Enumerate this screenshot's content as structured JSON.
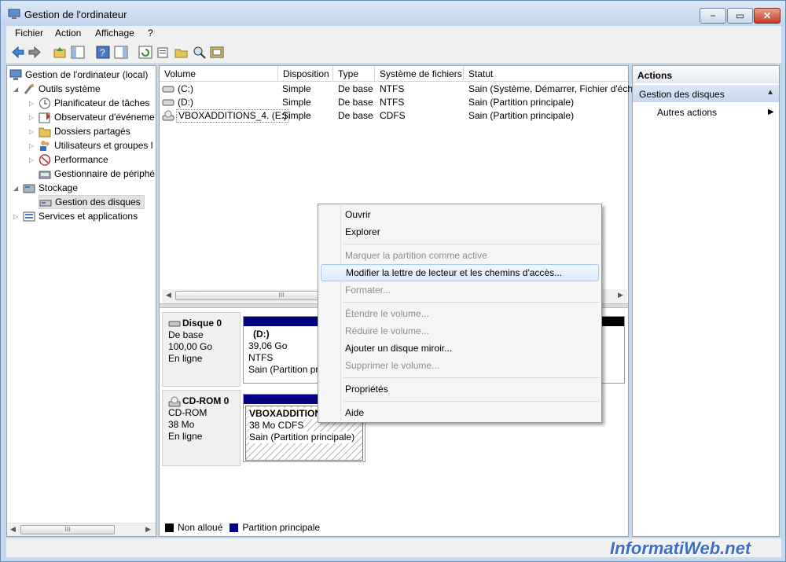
{
  "window": {
    "title": "Gestion de l'ordinateur",
    "min": "−",
    "max": "▭",
    "close": "✕"
  },
  "menu": [
    "Fichier",
    "Action",
    "Affichage",
    "?"
  ],
  "tree": {
    "root": "Gestion de l'ordinateur (local)",
    "system_tools": "Outils système",
    "task_scheduler": "Planificateur de tâches",
    "event_viewer": "Observateur d'événeme",
    "shared_folders": "Dossiers partagés",
    "users_groups": "Utilisateurs et groupes l",
    "performance": "Performance",
    "device_manager": "Gestionnaire de périphé",
    "storage": "Stockage",
    "disk_management": "Gestion des disques",
    "services": "Services et applications"
  },
  "volumes": {
    "headers": [
      "Volume",
      "Disposition",
      "Type",
      "Système de fichiers",
      "Statut"
    ],
    "rows": [
      {
        "volume": "(C:)",
        "layout": "Simple",
        "type": "De base",
        "fs": "NTFS",
        "status": "Sain (Système, Démarrer, Fichier d'éch"
      },
      {
        "volume": "(D:)",
        "layout": "Simple",
        "type": "De base",
        "fs": "NTFS",
        "status": "Sain (Partition principale)"
      },
      {
        "volume": "VBOXADDITIONS_4. (E:)",
        "layout": "Simple",
        "type": "De base",
        "fs": "CDFS",
        "status": "Sain (Partition principale)"
      }
    ]
  },
  "disks": {
    "disk0": {
      "name": "Disque 0",
      "type": "De base",
      "size": "100,00 Go",
      "state": "En ligne"
    },
    "disk0_part": {
      "name": "(D:)",
      "size": "39,06 Go NTFS",
      "status": "Sain (Partition princ"
    },
    "cdrom0": {
      "name": "CD-ROM 0",
      "type": "CD-ROM",
      "size": "38 Mo",
      "state": "En ligne"
    },
    "cdrom0_part": {
      "name": "VBOXADDITION",
      "size": "38 Mo CDFS",
      "status": "Sain (Partition principale)"
    }
  },
  "legend": {
    "unallocated": "Non alloué",
    "primary": "Partition principale",
    "unallocated_color": "#000000",
    "primary_color": "#000080"
  },
  "actions": {
    "title": "Actions",
    "group": "Gestion des disques",
    "item": "Autres actions"
  },
  "context_menu": {
    "open": "Ouvrir",
    "explore": "Explorer",
    "mark_active": "Marquer la partition comme active",
    "change_letter": "Modifier la lettre de lecteur et les chemins d'accès...",
    "format": "Formater...",
    "extend": "Étendre le volume...",
    "shrink": "Réduire le volume...",
    "add_mirror": "Ajouter un disque miroir...",
    "delete": "Supprimer le volume...",
    "properties": "Propriétés",
    "help": "Aide"
  },
  "watermark": "InformatiWeb.net",
  "scroll_mark": "III"
}
